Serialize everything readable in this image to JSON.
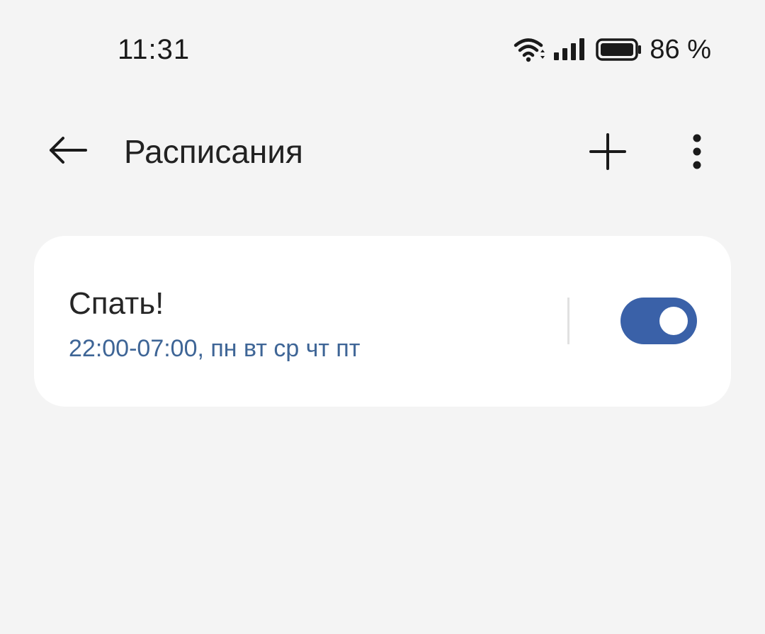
{
  "status_bar": {
    "time": "11:31",
    "battery_percent": "86 %",
    "wifi_icon": "wifi-icon",
    "signal_icon": "signal-icon",
    "battery_icon": "battery-icon"
  },
  "toolbar": {
    "title": "Расписания",
    "back_icon": "arrow-left-icon",
    "add_icon": "plus-icon",
    "more_icon": "more-vertical-icon"
  },
  "schedules": [
    {
      "name": "Спать!",
      "details": "22:00-07:00, пн вт ср чт пт",
      "enabled": true
    }
  ],
  "colors": {
    "background": "#f4f4f4",
    "card": "#ffffff",
    "accent": "#3a61a8",
    "details_text": "#3e6596"
  }
}
